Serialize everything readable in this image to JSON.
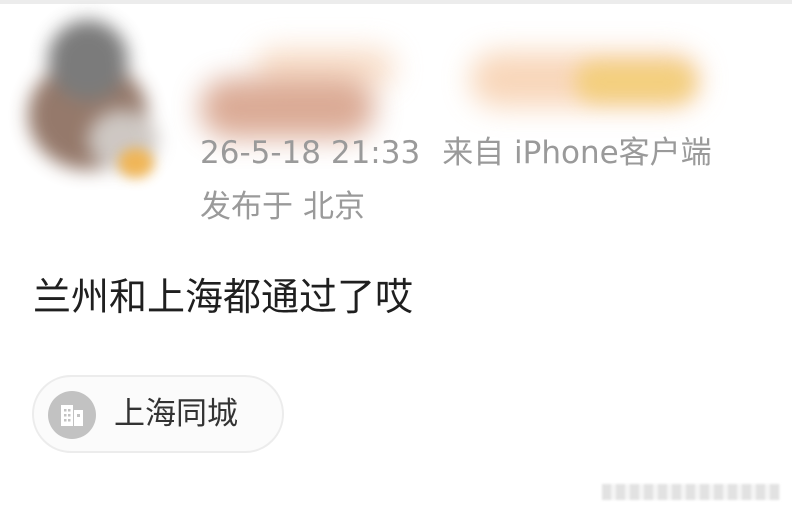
{
  "post": {
    "timestamp": "26-5-18 21:33",
    "source": "来自 iPhone客户端",
    "location_prefix": "发布于",
    "location_city": "北京",
    "content": "兰州和上海都通过了哎"
  },
  "topic": {
    "icon": "building-icon",
    "label": "上海同城"
  }
}
